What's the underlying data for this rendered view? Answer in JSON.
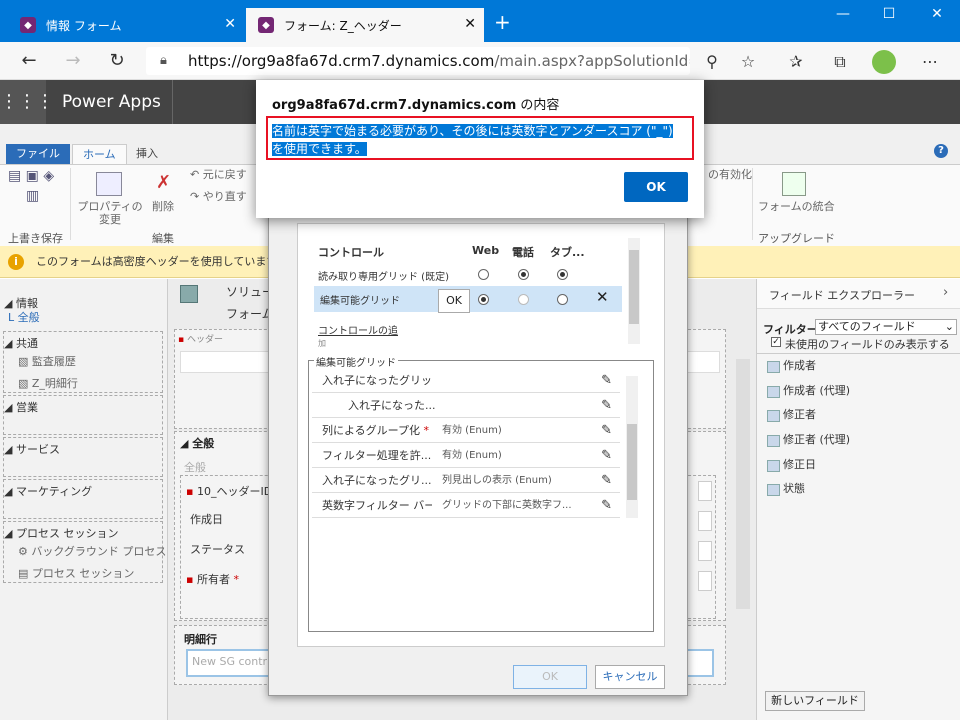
{
  "browser": {
    "tabs": [
      {
        "label": "情報 フォーム"
      },
      {
        "label": "フォーム: Z_ヘッダー"
      }
    ],
    "new_tab": "+",
    "url_domain": "https://org9a8fa67d.crm7.dynamics.com",
    "url_path": "/main.aspx?appSolutionId=..."
  },
  "app": {
    "name": "Power Apps"
  },
  "ribbon": {
    "tabs": {
      "file": "ファイル",
      "home": "ホーム",
      "insert": "挿入"
    },
    "undo": "元に戻す",
    "redo": "やり直す",
    "properties": "プロパティの\n変更",
    "delete": "削除",
    "group_save": "上書き保存",
    "group_edit": "編集",
    "enable": "の有効化",
    "merge": "フォームの統合",
    "group_upgrade": "アップグレード"
  },
  "infobar": {
    "text": "このフォームは高密度ヘッダーを使用しています。このフォ"
  },
  "leftnav": {
    "info_group": "情報",
    "info_all": "全般",
    "common": "共通",
    "audit": "監査履歴",
    "detail": "Z_明細行",
    "sales": "営業",
    "service": "サービス",
    "marketing": "マーケティング",
    "process_session": "プロセス セッション",
    "bg_process": "バックグラウンド プロセス",
    "process_session_item": "プロセス セッション"
  },
  "main": {
    "solution": "ソリュー",
    "form": "フォーム",
    "header_label": "ヘッダー",
    "general_section": "全般",
    "general_sub": "全般",
    "fields": [
      "10_ヘッダーID",
      "作成日",
      "ステータス",
      "所有者"
    ],
    "details_section": "明細行",
    "subgrid_placeholder": "New SG contr"
  },
  "dialog": {
    "col_control": "コントロール",
    "col_web": "Web",
    "col_phone": "電話",
    "col_tablet": "タブ...",
    "row1": "読み取り専用グリッド (既定)",
    "row2": "編集可能グリッド",
    "ok_tooltip": "OK",
    "add_control": "コントロールの追",
    "add_control2": "加",
    "props_group": "編集可能グリッド",
    "props": [
      {
        "name": "入れ子になったグリッ...",
        "value": ""
      },
      {
        "name": "入れ子になった...",
        "value": ""
      },
      {
        "name": "列によるグループ化",
        "value": "有効 (Enum)"
      },
      {
        "name": "フィルター処理を許...",
        "value": "有効 (Enum)"
      },
      {
        "name": "入れ子になったグリ...",
        "value": "列見出しの表示 (Enum)"
      },
      {
        "name": "英数字フィルター バー",
        "value": "グリッドの下部に英数字フ..."
      }
    ],
    "ok": "OK",
    "cancel": "キャンセル"
  },
  "explorer": {
    "title": "フィールド エクスプローラー",
    "filter_label": "フィルター",
    "filter_value": "すべてのフィールド",
    "unused_only": "未使用のフィールドのみ表示する",
    "fields": [
      "作成者",
      "作成者 (代理)",
      "修正者",
      "修正者 (代理)",
      "修正日",
      "状態"
    ],
    "new_field": "新しいフィールド"
  },
  "alert": {
    "domain": "org9a8fa67d.crm7.dynamics.com",
    "suffix": " の内容",
    "message": "名前は英字で始まる必要があり、その後には英数字とアンダースコア (\"_\") を使用できます。",
    "ok": "OK"
  },
  "colors": {
    "accent": "#0078d7",
    "alert_border": "#e81123",
    "app_bar": "#444444",
    "info_bar": "#fff1b8"
  }
}
